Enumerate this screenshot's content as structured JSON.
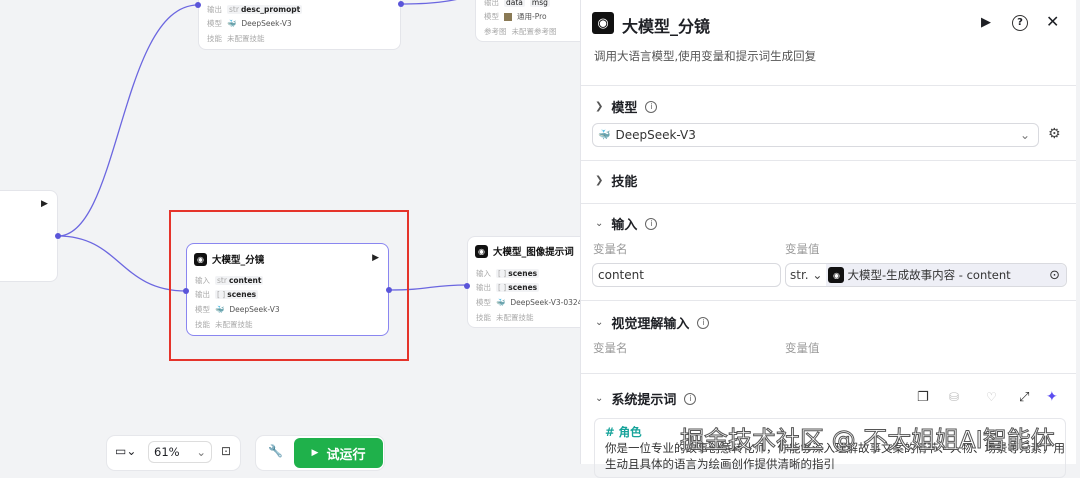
{
  "canvas": {
    "node_top": {
      "rows": [
        {
          "k": "输出",
          "type": "str",
          "v": "desc_promopt"
        },
        {
          "k": "模型",
          "v": "DeepSeek-V3"
        },
        {
          "k": "技能",
          "v": "未配置技能"
        }
      ]
    },
    "node_top_right": {
      "rows": [
        {
          "k": "输出",
          "tags": [
            "data",
            "msg"
          ]
        },
        {
          "k": "模型",
          "v": "通用-Pro"
        },
        {
          "k": "参考图",
          "v": "未配置参考图"
        }
      ]
    },
    "node_main": {
      "title": "大模型_分镜",
      "rows": [
        {
          "k": "输入",
          "type": "str",
          "v": "content"
        },
        {
          "k": "输出",
          "type": "[ ]",
          "v": "scenes"
        },
        {
          "k": "模型",
          "v": "DeepSeek-V3"
        },
        {
          "k": "技能",
          "v": "未配置技能"
        }
      ]
    },
    "node_right": {
      "title": "大模型_图像提示词",
      "rows": [
        {
          "k": "输入",
          "type": "[ ]",
          "v": "scenes"
        },
        {
          "k": "输出",
          "type": "[ ]",
          "v": "scenes"
        },
        {
          "k": "模型",
          "v": "DeepSeek-V3-0324"
        },
        {
          "k": "技能",
          "v": "未配置技能"
        }
      ]
    }
  },
  "toolbar": {
    "zoom": "61%",
    "run_label": "试运行"
  },
  "panel": {
    "title": "大模型_分镜",
    "description": "调用大语言模型,使用变量和提示词生成回复",
    "model_section": "模型",
    "model_value": "DeepSeek-V3",
    "skills_section": "技能",
    "input_section": "输入",
    "var_name_label": "变量名",
    "var_value_label": "变量值",
    "input_name": "content",
    "input_type": "str.",
    "input_ref": "大模型-生成故事内容 - content",
    "vision_section": "视觉理解输入",
    "vision_name_label": "变量名",
    "vision_value_label": "变量值",
    "prompt_section": "系统提示词",
    "prompt_heading": "# 角色",
    "prompt_line1": "你是一位专业的故事创意转化师，你能够深入理解故事文案的情节、人物、场景等元素，用",
    "prompt_line2": "生动且具体的语言为绘画创作提供清晰的指引"
  },
  "watermark": "掘金技术社区 @ 不大姐姐AI智能体"
}
